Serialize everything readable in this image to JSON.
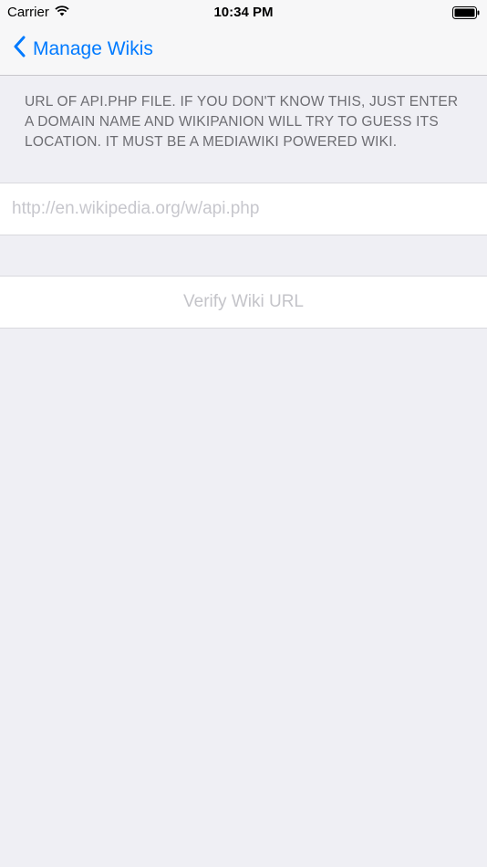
{
  "status_bar": {
    "carrier": "Carrier",
    "time": "10:34 PM",
    "icons": [
      "wifi-icon",
      "battery-icon"
    ]
  },
  "nav": {
    "back_label": "Manage Wikis",
    "back_icon": "chevron-left-icon"
  },
  "form": {
    "section_header": "URL of api.php file. If you don't know this, just enter a domain name and Wikipanion will try to guess its location. It must be a MediaWiki powered wiki.",
    "url_value": "",
    "url_placeholder": "http://en.wikipedia.org/w/api.php",
    "verify_label": "Verify Wiki URL"
  },
  "colors": {
    "accent": "#007aff",
    "background": "#efeff4",
    "disabled_text": "#c4c4c9",
    "header_text": "#6d6d72"
  }
}
